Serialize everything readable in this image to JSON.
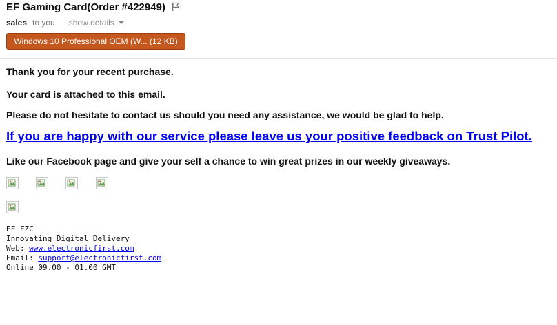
{
  "header": {
    "subject": "EF Gaming Card(Order #422949)",
    "sender": "sales",
    "to": "to you",
    "show_details": "show details",
    "attachment_label": "Windows 10 Professional OEM (W... (12 KB)"
  },
  "body": {
    "line1": "Thank you for your recent purchase.",
    "line2": "Your card is attached to this email.",
    "line3": "Please do not hesitate to contact us should you need any assistance, we would be glad to help.",
    "trustpilot_link": "If you are happy with our service please leave us your positive feedback on Trust Pilot.",
    "line4": "Like our Facebook page and give your self a chance to win great prizes in our weekly giveaways."
  },
  "signature": {
    "company": "EF FZC",
    "tagline": "Innovating Digital Delivery",
    "web_label": "Web:",
    "web_link": "www.electronicfirst.com",
    "email_label": "Email:",
    "email_link": "support@electronicfirst.com",
    "hours": "Online 09.00 - 01.00 GMT"
  },
  "colors": {
    "attachment_bg": "#c4581f",
    "link": "#0000ee"
  },
  "icons": [
    "flag-icon",
    "chevron-down-icon",
    "broken-image-icon"
  ]
}
